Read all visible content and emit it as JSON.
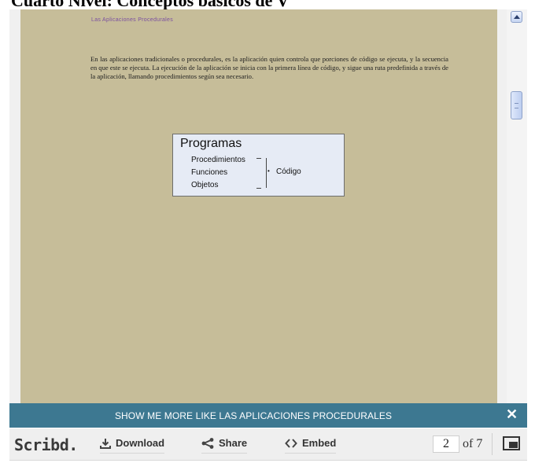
{
  "top_heading": "Cuarto Nivel: Conceptos básicos de V",
  "document": {
    "header": "Las Aplicaciones Procedurales",
    "paragraph": "En las aplicaciones tradicionales o procedurales, es la aplicación quien controla que porciones de código se ejecuta, y la secuencia en que este se ejecuta. La ejecución de la aplicación se inicia con la primera línea de código, y sigue una ruta predefinida a través de la aplicación, llamando procedimientos según sea necesario.",
    "diagram": {
      "title": "Programas",
      "items": [
        "Procedimientos",
        "Funciones",
        "Objetos"
      ],
      "target": "Código"
    }
  },
  "banner": {
    "text": "SHOW ME MORE LIKE LAS APLICACIONES PROCEDURALES",
    "close_glyph": "✕"
  },
  "toolbar": {
    "logo": "Scribd.",
    "download_label": "Download",
    "share_label": "Share",
    "embed_label": "Embed",
    "current_page": "2",
    "page_total": "of 7"
  },
  "colors": {
    "page_bg": "#c6bd99",
    "banner_bg": "#3d7891",
    "toolbar_bg": "#efefef",
    "diagram_bg": "#e6ebf5"
  },
  "icons": [
    "download-icon",
    "share-icon",
    "embed-icon",
    "fullscreen-icon",
    "scroll-up-icon"
  ]
}
